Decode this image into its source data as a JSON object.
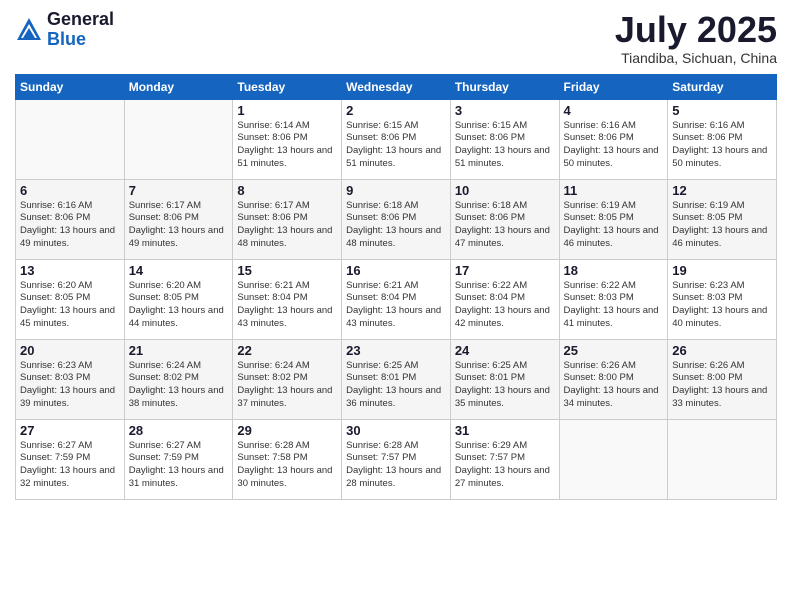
{
  "header": {
    "logo_general": "General",
    "logo_blue": "Blue",
    "month_title": "July 2025",
    "location": "Tiandiba, Sichuan, China"
  },
  "weekdays": [
    "Sunday",
    "Monday",
    "Tuesday",
    "Wednesday",
    "Thursday",
    "Friday",
    "Saturday"
  ],
  "weeks": [
    [
      {
        "day": "",
        "info": ""
      },
      {
        "day": "",
        "info": ""
      },
      {
        "day": "1",
        "info": "Sunrise: 6:14 AM\nSunset: 8:06 PM\nDaylight: 13 hours and 51 minutes."
      },
      {
        "day": "2",
        "info": "Sunrise: 6:15 AM\nSunset: 8:06 PM\nDaylight: 13 hours and 51 minutes."
      },
      {
        "day": "3",
        "info": "Sunrise: 6:15 AM\nSunset: 8:06 PM\nDaylight: 13 hours and 51 minutes."
      },
      {
        "day": "4",
        "info": "Sunrise: 6:16 AM\nSunset: 8:06 PM\nDaylight: 13 hours and 50 minutes."
      },
      {
        "day": "5",
        "info": "Sunrise: 6:16 AM\nSunset: 8:06 PM\nDaylight: 13 hours and 50 minutes."
      }
    ],
    [
      {
        "day": "6",
        "info": "Sunrise: 6:16 AM\nSunset: 8:06 PM\nDaylight: 13 hours and 49 minutes."
      },
      {
        "day": "7",
        "info": "Sunrise: 6:17 AM\nSunset: 8:06 PM\nDaylight: 13 hours and 49 minutes."
      },
      {
        "day": "8",
        "info": "Sunrise: 6:17 AM\nSunset: 8:06 PM\nDaylight: 13 hours and 48 minutes."
      },
      {
        "day": "9",
        "info": "Sunrise: 6:18 AM\nSunset: 8:06 PM\nDaylight: 13 hours and 48 minutes."
      },
      {
        "day": "10",
        "info": "Sunrise: 6:18 AM\nSunset: 8:06 PM\nDaylight: 13 hours and 47 minutes."
      },
      {
        "day": "11",
        "info": "Sunrise: 6:19 AM\nSunset: 8:05 PM\nDaylight: 13 hours and 46 minutes."
      },
      {
        "day": "12",
        "info": "Sunrise: 6:19 AM\nSunset: 8:05 PM\nDaylight: 13 hours and 46 minutes."
      }
    ],
    [
      {
        "day": "13",
        "info": "Sunrise: 6:20 AM\nSunset: 8:05 PM\nDaylight: 13 hours and 45 minutes."
      },
      {
        "day": "14",
        "info": "Sunrise: 6:20 AM\nSunset: 8:05 PM\nDaylight: 13 hours and 44 minutes."
      },
      {
        "day": "15",
        "info": "Sunrise: 6:21 AM\nSunset: 8:04 PM\nDaylight: 13 hours and 43 minutes."
      },
      {
        "day": "16",
        "info": "Sunrise: 6:21 AM\nSunset: 8:04 PM\nDaylight: 13 hours and 43 minutes."
      },
      {
        "day": "17",
        "info": "Sunrise: 6:22 AM\nSunset: 8:04 PM\nDaylight: 13 hours and 42 minutes."
      },
      {
        "day": "18",
        "info": "Sunrise: 6:22 AM\nSunset: 8:03 PM\nDaylight: 13 hours and 41 minutes."
      },
      {
        "day": "19",
        "info": "Sunrise: 6:23 AM\nSunset: 8:03 PM\nDaylight: 13 hours and 40 minutes."
      }
    ],
    [
      {
        "day": "20",
        "info": "Sunrise: 6:23 AM\nSunset: 8:03 PM\nDaylight: 13 hours and 39 minutes."
      },
      {
        "day": "21",
        "info": "Sunrise: 6:24 AM\nSunset: 8:02 PM\nDaylight: 13 hours and 38 minutes."
      },
      {
        "day": "22",
        "info": "Sunrise: 6:24 AM\nSunset: 8:02 PM\nDaylight: 13 hours and 37 minutes."
      },
      {
        "day": "23",
        "info": "Sunrise: 6:25 AM\nSunset: 8:01 PM\nDaylight: 13 hours and 36 minutes."
      },
      {
        "day": "24",
        "info": "Sunrise: 6:25 AM\nSunset: 8:01 PM\nDaylight: 13 hours and 35 minutes."
      },
      {
        "day": "25",
        "info": "Sunrise: 6:26 AM\nSunset: 8:00 PM\nDaylight: 13 hours and 34 minutes."
      },
      {
        "day": "26",
        "info": "Sunrise: 6:26 AM\nSunset: 8:00 PM\nDaylight: 13 hours and 33 minutes."
      }
    ],
    [
      {
        "day": "27",
        "info": "Sunrise: 6:27 AM\nSunset: 7:59 PM\nDaylight: 13 hours and 32 minutes."
      },
      {
        "day": "28",
        "info": "Sunrise: 6:27 AM\nSunset: 7:59 PM\nDaylight: 13 hours and 31 minutes."
      },
      {
        "day": "29",
        "info": "Sunrise: 6:28 AM\nSunset: 7:58 PM\nDaylight: 13 hours and 30 minutes."
      },
      {
        "day": "30",
        "info": "Sunrise: 6:28 AM\nSunset: 7:57 PM\nDaylight: 13 hours and 28 minutes."
      },
      {
        "day": "31",
        "info": "Sunrise: 6:29 AM\nSunset: 7:57 PM\nDaylight: 13 hours and 27 minutes."
      },
      {
        "day": "",
        "info": ""
      },
      {
        "day": "",
        "info": ""
      }
    ]
  ]
}
